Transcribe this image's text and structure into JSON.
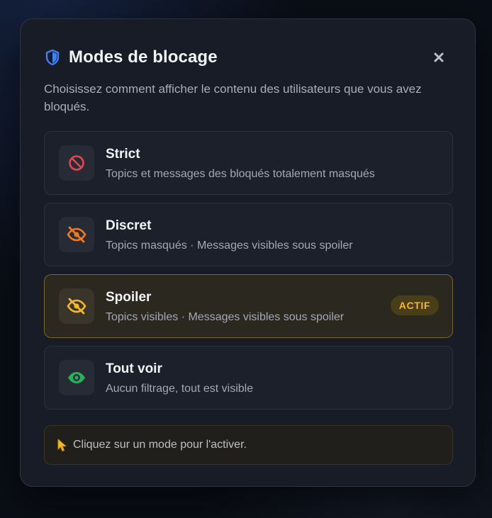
{
  "modal": {
    "title": "Modes de blocage",
    "description": "Choisissez comment afficher le contenu des utilisateurs que vous avez bloqués.",
    "icon": "shield-icon",
    "close_icon": "close-icon",
    "accent": "#3b82f6"
  },
  "modes": [
    {
      "name": "Strict",
      "description": "Topics et messages des bloqués totalement masqués",
      "icon": "block-icon",
      "icon_color": "#e5484d",
      "active": false
    },
    {
      "name": "Discret",
      "description": "Topics masqués · Messages visibles sous spoiler",
      "icon": "eye-slash-icon",
      "icon_color": "#f07a1e",
      "active": false
    },
    {
      "name": "Spoiler",
      "description": "Topics visibles · Messages visibles sous spoiler",
      "icon": "eye-slash-icon",
      "icon_color": "#f2b827",
      "active": true,
      "badge": "ACTIF"
    },
    {
      "name": "Tout voir",
      "description": "Aucun filtrage, tout est visible",
      "icon": "eye-icon",
      "icon_color": "#22b45a",
      "active": false
    }
  ],
  "hint": {
    "icon": "pointer-icon",
    "text": "Cliquez sur un mode pour l'activer."
  }
}
